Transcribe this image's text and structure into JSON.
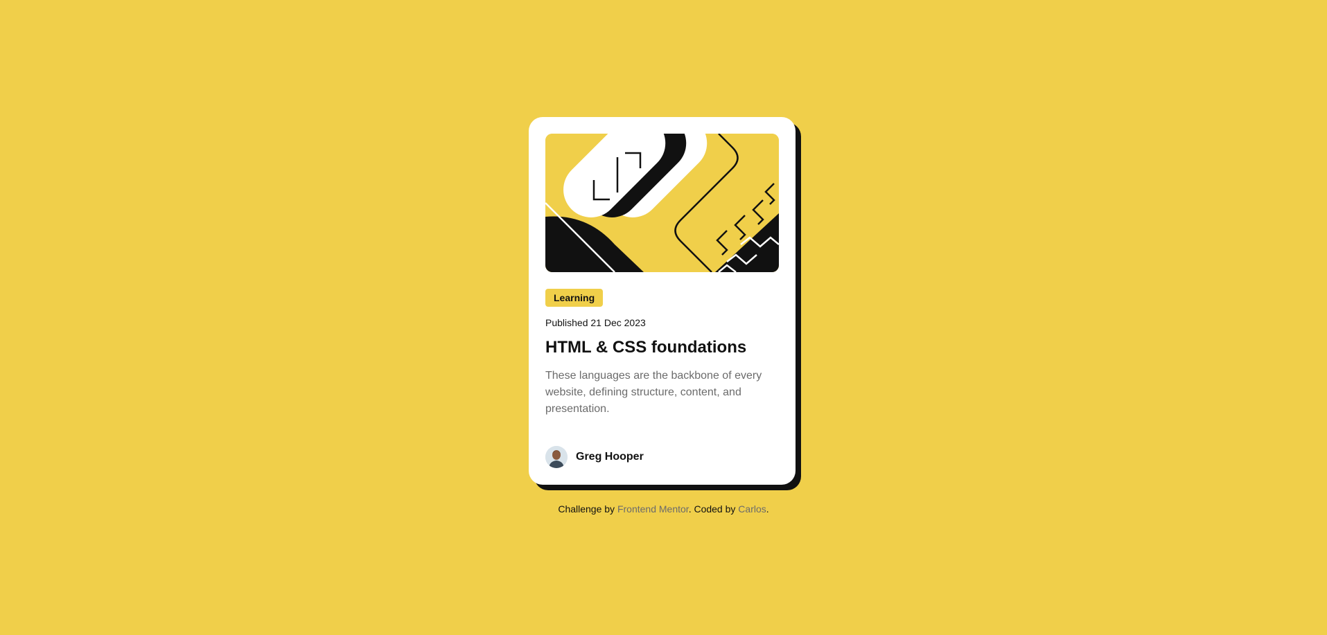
{
  "card": {
    "image_alt": "illustration",
    "tag": "Learning",
    "published": "Published 21 Dec 2023",
    "title": "HTML & CSS foundations",
    "description": "These languages are the backbone of every website, defining structure, content, and presentation.",
    "author": {
      "name": "Greg Hooper",
      "avatar_icon": "avatar-photo"
    }
  },
  "footer": {
    "prefix": "Challenge by ",
    "link1": "Frontend Mentor",
    "middle": ". Coded by ",
    "link2": "Carlos",
    "suffix": "."
  },
  "colors": {
    "background": "#F0CF4A",
    "card": "#FFFFFF",
    "shadow": "#111111",
    "muted_text": "#6B6B6B"
  }
}
